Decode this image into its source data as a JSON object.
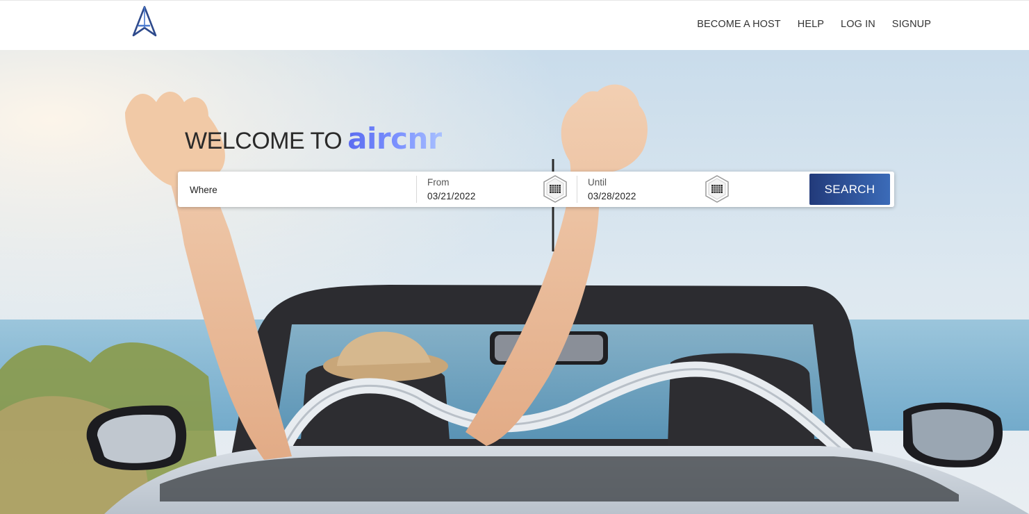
{
  "header": {
    "logo_icon": "aircnr-a-logo-icon",
    "nav": {
      "become_host": "BECOME A HOST",
      "help": "HELP",
      "login": "LOG IN",
      "signup": "SIGNUP"
    }
  },
  "hero": {
    "welcome_prefix": "WELCOME TO",
    "brand": "aircnr",
    "brand_colors": [
      "#5b6cf0",
      "#a9c1ff"
    ]
  },
  "search": {
    "where_placeholder": "Where",
    "from_label": "From",
    "from_value": "03/21/2022",
    "until_label": "Until",
    "until_value": "03/28/2022",
    "calendar_icon": "calendar-icon",
    "button_label": "SEARCH",
    "button_color": "#2c4a94"
  }
}
